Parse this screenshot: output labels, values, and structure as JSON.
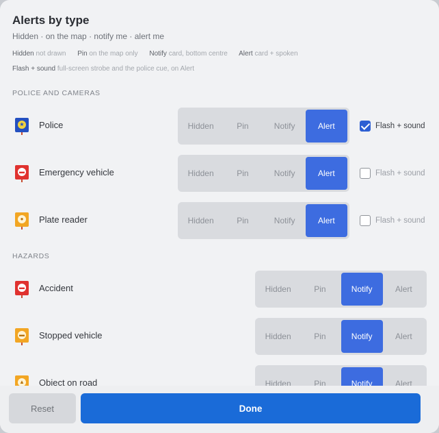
{
  "dialog": {
    "title": "Alerts by type",
    "subtitle": "Hidden · on the map · notify me · alert me",
    "legend": [
      {
        "term": "Hidden",
        "desc": "not drawn"
      },
      {
        "term": "Pin",
        "desc": "on the map only"
      },
      {
        "term": "Notify",
        "desc": "card, bottom centre"
      },
      {
        "term": "Alert",
        "desc": "card + spoken"
      }
    ],
    "legend_flash": {
      "term": "Flash + sound",
      "desc": "full-screen strobe and the police cue, on Alert"
    }
  },
  "segment_options": [
    "Hidden",
    "Pin",
    "Notify",
    "Alert"
  ],
  "flash_label": "Flash + sound",
  "sections": [
    {
      "heading": "POLICE AND CAMERAS",
      "rows": [
        {
          "label": "Police",
          "icon": "police-icon",
          "selected": "Alert",
          "flash": true
        },
        {
          "label": "Emergency vehicle",
          "icon": "emergency-vehicle-icon",
          "selected": "Alert",
          "flash": false
        },
        {
          "label": "Plate reader",
          "icon": "plate-reader-icon",
          "selected": "Alert",
          "flash": false
        }
      ]
    },
    {
      "heading": "HAZARDS",
      "rows": [
        {
          "label": "Accident",
          "icon": "accident-icon",
          "selected": "Notify"
        },
        {
          "label": "Stopped vehicle",
          "icon": "stopped-vehicle-icon",
          "selected": "Notify"
        },
        {
          "label": "Object on road",
          "icon": "object-on-road-icon",
          "selected": "Notify"
        }
      ]
    }
  ],
  "footer": {
    "reset_label": "Reset",
    "done_label": "Done"
  },
  "colors": {
    "accent": "#3d6ce0",
    "done": "#1a6bd8",
    "police_icon": "#2450c0",
    "red_icon": "#e0322f",
    "yellow_icon": "#f2a623"
  }
}
